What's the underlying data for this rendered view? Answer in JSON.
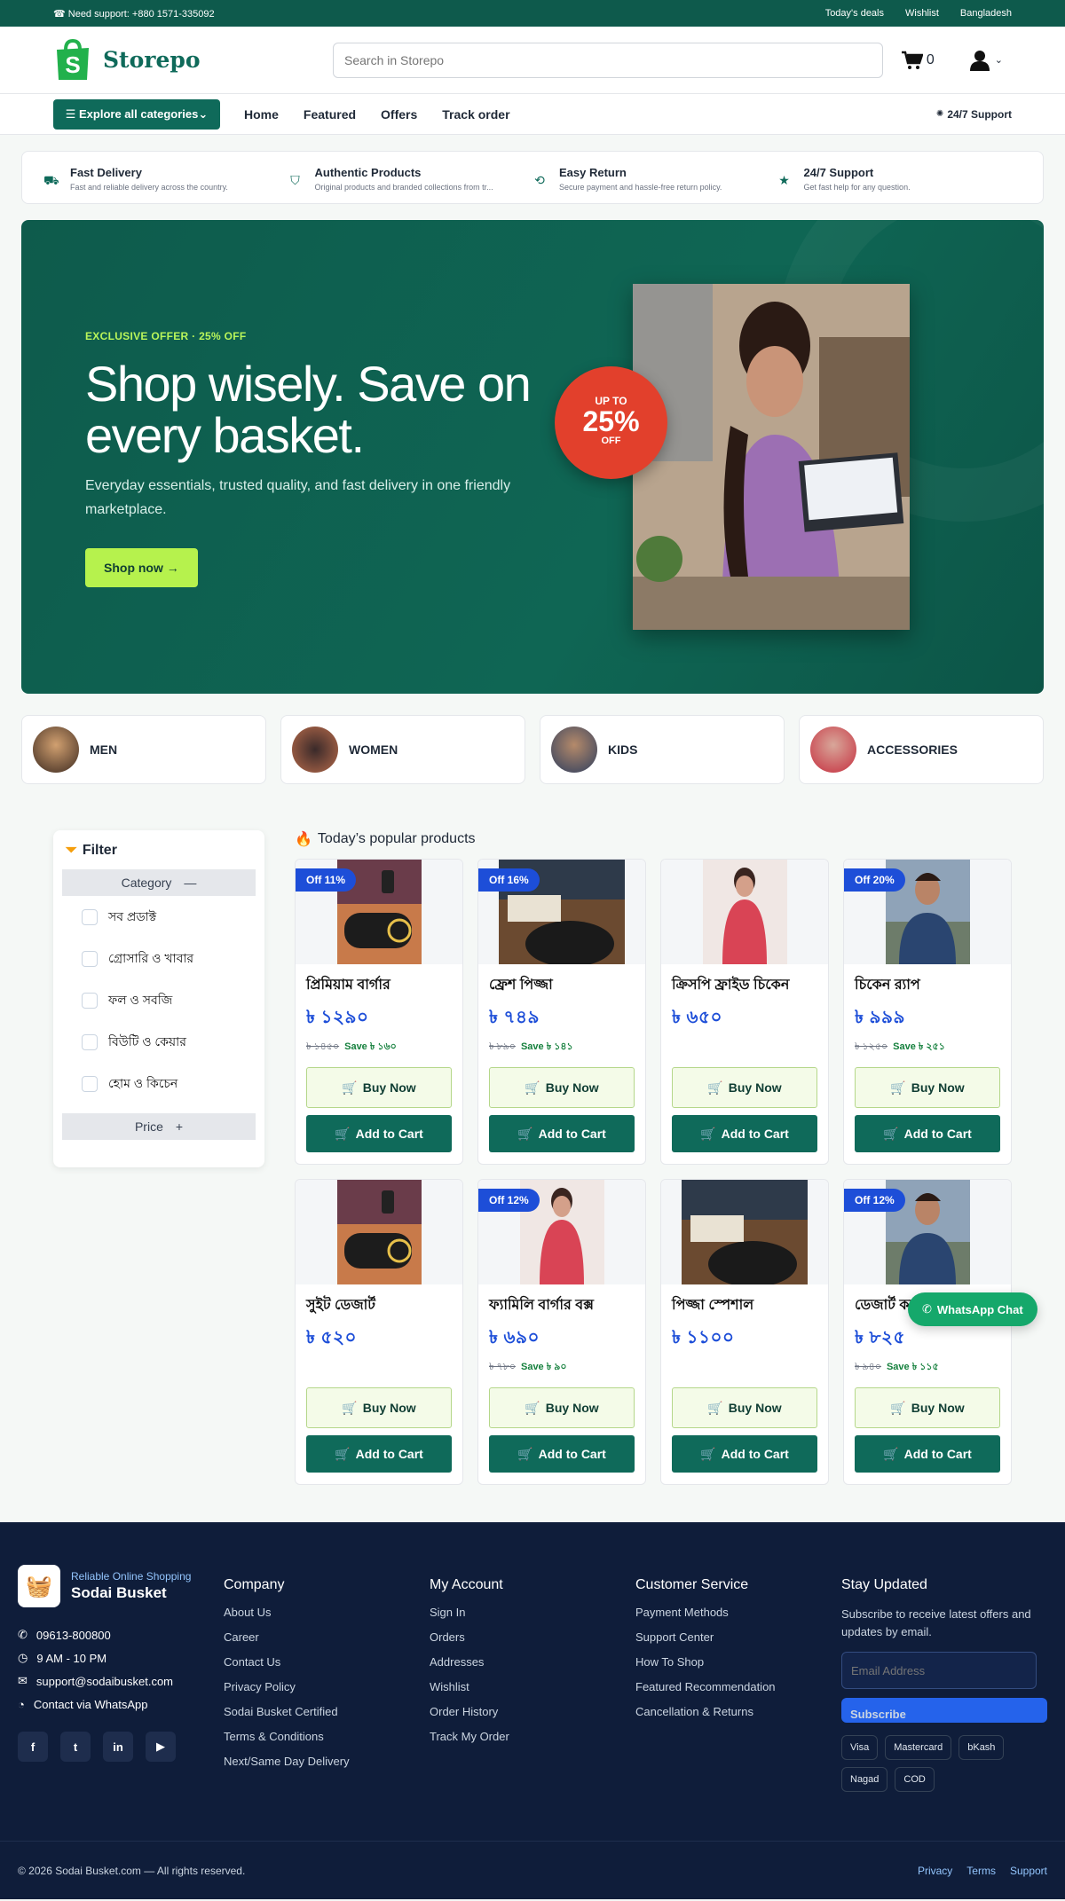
{
  "topbar": {
    "support": "☎ Need support: +880 1571-335092",
    "links": [
      "Today's deals",
      "Wishlist",
      "Bangladesh"
    ]
  },
  "header": {
    "brand": "Storepo",
    "search_placeholder": "Search in Storepo",
    "cart_count": "0"
  },
  "nav": {
    "categories_btn": "☰ Explore all categories⌄",
    "links": [
      "Home",
      "Featured",
      "Offers",
      "Track order"
    ],
    "support": "24/7 Support"
  },
  "features": [
    {
      "icon": "truck-icon",
      "title": "Fast Delivery",
      "desc": "Fast and reliable delivery across the country."
    },
    {
      "icon": "shield-icon",
      "title": "Authentic Products",
      "desc": "Original products and branded collections from tr..."
    },
    {
      "icon": "refresh-icon",
      "title": "Easy Return",
      "desc": "Secure payment and hassle-free return policy."
    },
    {
      "icon": "star-icon",
      "title": "24/7 Support",
      "desc": "Get fast help for any question."
    }
  ],
  "hero": {
    "eyebrow": "EXCLUSIVE OFFER · 25% OFF",
    "title": "Shop wisely. Save on every basket.",
    "subtitle": "Everyday essentials, trusted quality, and fast delivery in one friendly marketplace.",
    "cta": "Shop now →",
    "badge": {
      "up": "UP TO",
      "pct": "25%",
      "off": "OFF"
    }
  },
  "categories": [
    "MEN",
    "WOMEN",
    "KIDS",
    "ACCESSORIES"
  ],
  "filter": {
    "title": "Filter",
    "category_label": "Category",
    "items": [
      "সব প্রডাক্ট",
      "গ্রোসারি ও খাবার",
      "ফল ও সবজি",
      "বিউটি ও কেয়ার",
      "হোম ও কিচেন"
    ],
    "price_label": "Price"
  },
  "products_title": "Today’s popular products",
  "products": [
    {
      "off": "Off 11%",
      "name": "প্রিমিয়াম বার্গার",
      "price": "৳ ১২৯০",
      "old": "৳ ১৪৫০",
      "save": "Save ৳ ১৬০",
      "img": "speaker"
    },
    {
      "off": "Off 16%",
      "name": "ফ্রেশ পিজ্জা",
      "price": "৳ ৭৪৯",
      "old": "৳ ৮৯০",
      "save": "Save ৳ ১৪১",
      "img": "table"
    },
    {
      "off": "",
      "name": "ক্রিসপি ফ্রাইড চিকেন",
      "price": "৳ ৬৫০",
      "old": "",
      "save": "",
      "img": "woman"
    },
    {
      "off": "Off 20%",
      "name": "চিকেন র‍্যাপ",
      "price": "৳ ৯৯৯",
      "old": "৳ ১২৫০",
      "save": "Save ৳ ২৫১",
      "img": "man"
    },
    {
      "off": "",
      "name": "সুইট ডেজার্ট",
      "price": "৳ ৫২০",
      "old": "",
      "save": "",
      "img": "speaker"
    },
    {
      "off": "Off 12%",
      "name": "ফ্যামিলি বার্গার বক্স",
      "price": "৳ ৬৯০",
      "old": "৳ ৭৮০",
      "save": "Save ৳ ৯০",
      "img": "woman"
    },
    {
      "off": "",
      "name": "পিজ্জা স্পেশাল",
      "price": "৳ ১১০০",
      "old": "",
      "save": "",
      "img": "table"
    },
    {
      "off": "Off 12%",
      "name": "ডেজার্ট কম",
      "price": "৳ ৮২৫",
      "old": "৳ ৯৪০",
      "save": "Save ৳ ১১৫",
      "img": "man"
    }
  ],
  "buttons": {
    "buy": "Buy Now",
    "cart": "Add to Cart"
  },
  "whatsapp": "WhatsApp Chat",
  "footer": {
    "tagline": "Reliable Online Shopping",
    "brand": "Sodai Busket",
    "contact": [
      "09613-800800",
      "9 AM - 10 PM",
      "support@sodaibusket.com",
      "Contact via WhatsApp"
    ],
    "social": [
      "f",
      "t",
      "in",
      "▶"
    ],
    "columns": [
      {
        "title": "Company",
        "links": [
          "About Us",
          "Career",
          "Contact Us",
          "Privacy Policy",
          "Sodai Busket Certified",
          "Terms & Conditions",
          "Next/Same Day Delivery"
        ]
      },
      {
        "title": "My Account",
        "links": [
          "Sign In",
          "Orders",
          "Addresses",
          "Wishlist",
          "Order History",
          "Track My Order"
        ]
      },
      {
        "title": "Customer Service",
        "links": [
          "Payment Methods",
          "Support Center",
          "How To Shop",
          "Featured Recommendation",
          "Cancellation & Returns"
        ]
      }
    ],
    "stay": {
      "title": "Stay Updated",
      "text": "Subscribe to receive latest offers and updates by email.",
      "placeholder": "Email Address",
      "button": "Subscribe",
      "pays": [
        "Visa",
        "Mastercard",
        "bKash",
        "Nagad",
        "COD"
      ]
    },
    "copyright": "© 2026 Sodai Busket.com — All rights reserved.",
    "bottom_links": [
      "Privacy",
      "Terms",
      "Support"
    ]
  }
}
